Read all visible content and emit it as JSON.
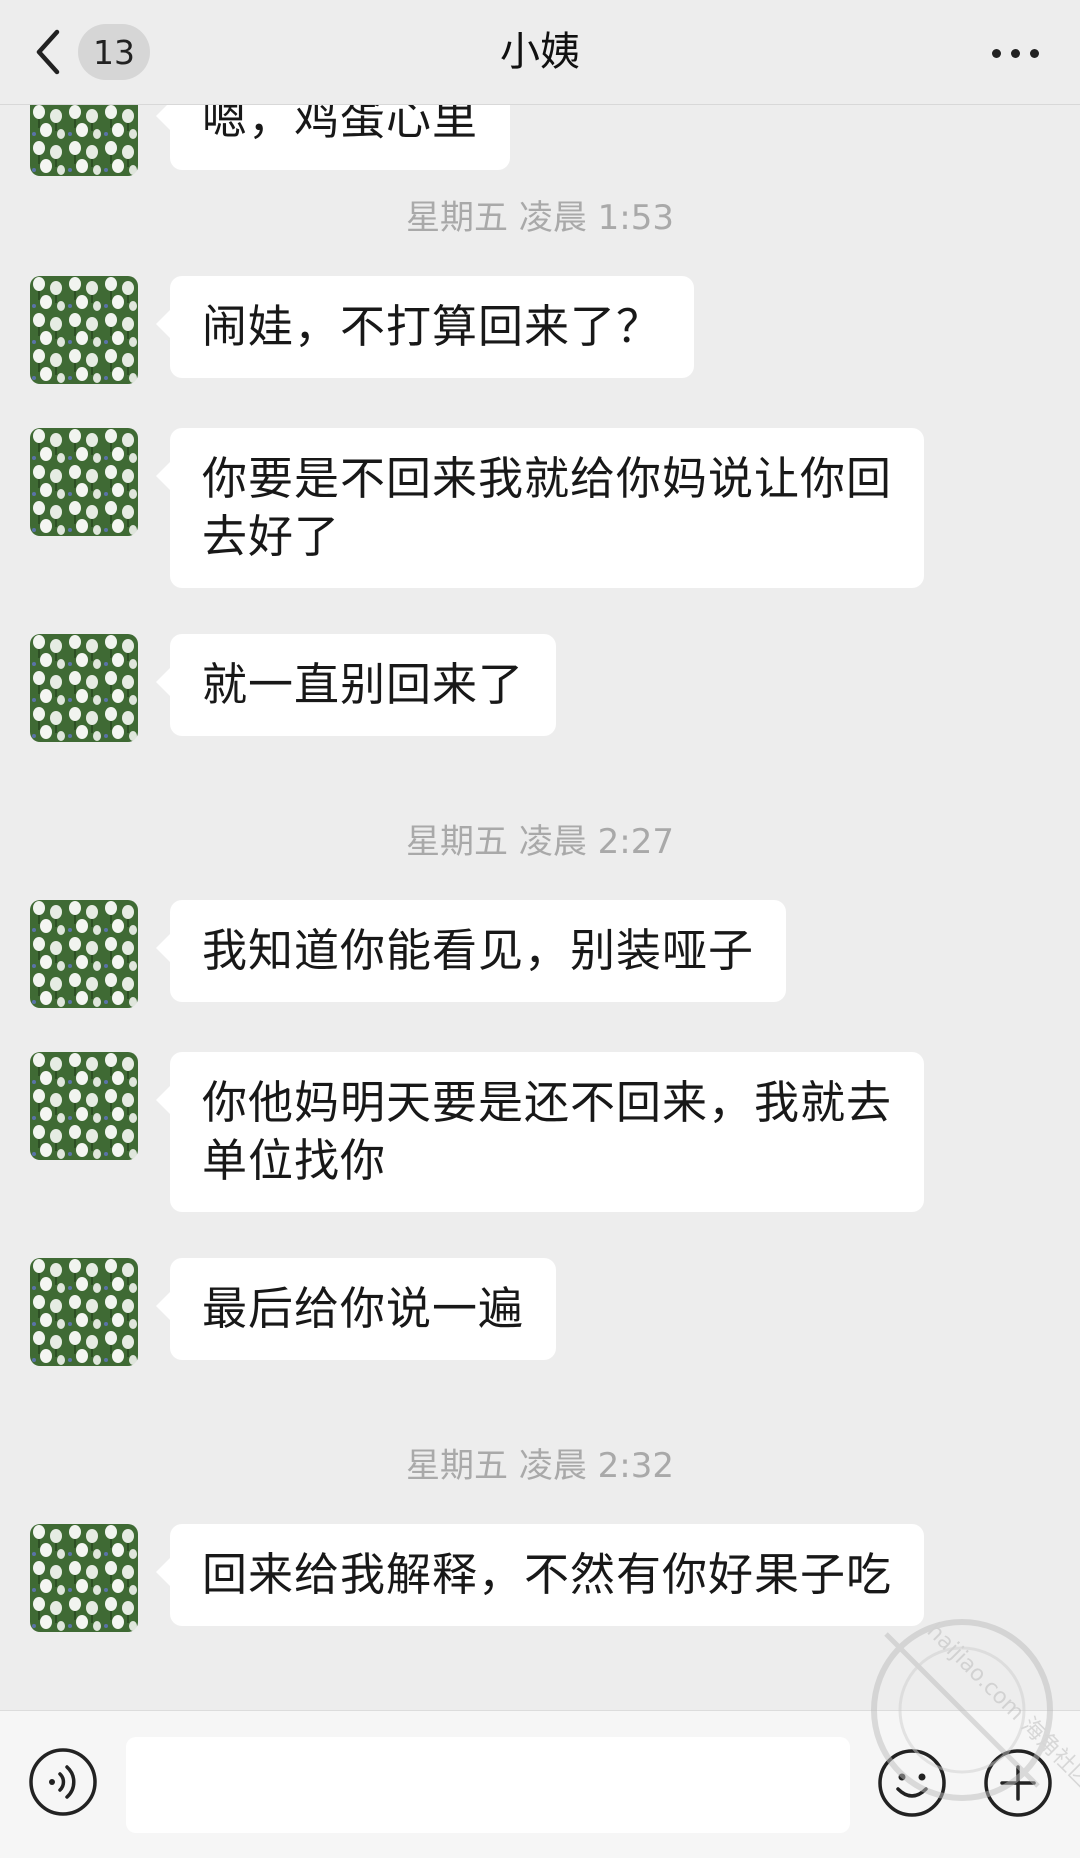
{
  "header": {
    "back_icon": "chevron-left-icon",
    "unread_count": "13",
    "title": "小姨",
    "more_icon": "more-dots-icon"
  },
  "messages": [
    {
      "type": "text",
      "text": "嗯，鸡蛋心里"
    },
    {
      "type": "time",
      "text": "星期五 凌晨 1:53"
    },
    {
      "type": "text",
      "text": "闹娃，不打算回来了？"
    },
    {
      "type": "text",
      "text": "你要是不回来我就给你妈说让你回",
      "text2": "去好了"
    },
    {
      "type": "text",
      "text": "就一直别回来了"
    },
    {
      "type": "time",
      "text": "星期五 凌晨 2:27"
    },
    {
      "type": "text",
      "text": "我知道你能看见，别装哑子"
    },
    {
      "type": "text",
      "text": "你他妈明天要是还不回来，我就去",
      "text2": "单位找你"
    },
    {
      "type": "text",
      "text": "最后给你说一遍"
    },
    {
      "type": "time",
      "text": "星期五 凌晨 2:32"
    },
    {
      "type": "text",
      "text": "回来给我解释，不然有你好果子吃"
    }
  ],
  "input_bar": {
    "voice_icon": "voice-icon",
    "input_value": "",
    "emoji_icon": "emoji-icon",
    "plus_icon": "plus-icon"
  },
  "watermark": {
    "text": "haijiao.com 海角社区"
  },
  "colors": {
    "background": "#ededed",
    "bubble": "#ffffff",
    "timestamp": "#a9a9a9"
  }
}
